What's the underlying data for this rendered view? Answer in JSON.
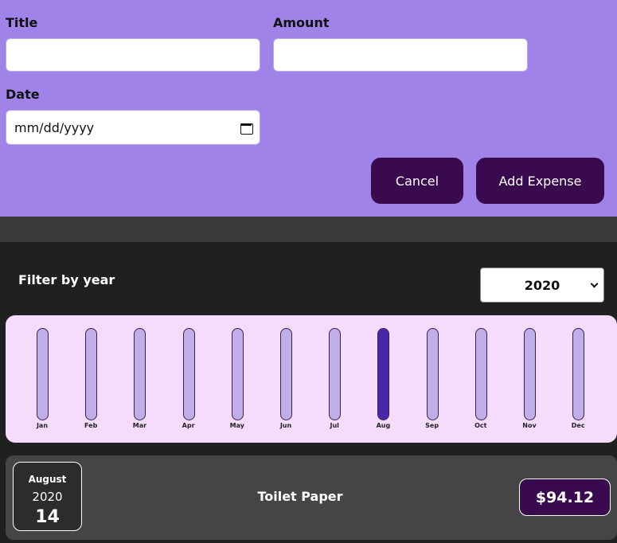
{
  "form": {
    "title_label": "Title",
    "title_value": "",
    "amount_label": "Amount",
    "amount_value": "",
    "date_label": "Date",
    "date_placeholder": "mm/dd/yyyy",
    "cancel_label": "Cancel",
    "add_label": "Add Expense"
  },
  "filter": {
    "label": "Filter by year",
    "selected_year": "2020"
  },
  "colors": {
    "form_bg": "#a083e8",
    "button_bg": "#3a0a4f",
    "chart_bg": "#f5dbfc",
    "bar_empty": "#c0aee8",
    "bar_fill": "#4826a8"
  },
  "chart_data": {
    "type": "bar",
    "categories": [
      "Jan",
      "Feb",
      "Mar",
      "Apr",
      "May",
      "Jun",
      "Jul",
      "Aug",
      "Sep",
      "Oct",
      "Nov",
      "Dec"
    ],
    "values": [
      0,
      0,
      0,
      0,
      0,
      0,
      0,
      94.12,
      0,
      0,
      0,
      0
    ],
    "ylim": [
      0,
      94.12
    ]
  },
  "expenses": [
    {
      "month": "August",
      "year": "2020",
      "day": "14",
      "title": "Toilet Paper",
      "amount": "$94.12"
    }
  ]
}
